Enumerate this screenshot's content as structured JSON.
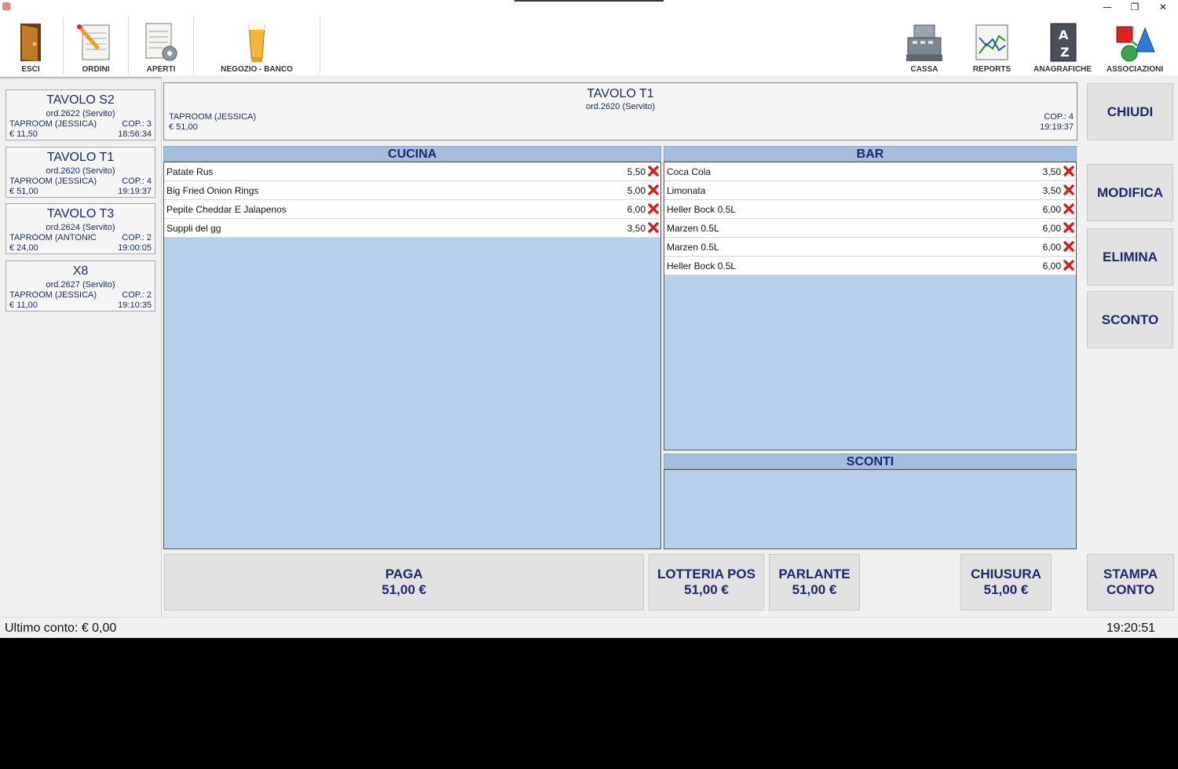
{
  "window": {
    "minimize_glyph": "—",
    "restore_glyph": "❐",
    "close_glyph": "✕"
  },
  "toolbar": {
    "esci": "ESCI",
    "ordini": "ORDINI",
    "aperti": "APERTI",
    "negozio": "NEGOZIO - BANCO",
    "cassa": "CASSA",
    "reports": "REPORTS",
    "anagrafiche": "ANAGRAFICHE",
    "associazioni": "ASSOCIAZIONI"
  },
  "tables": [
    {
      "name": "TAVOLO S2",
      "order": "ord.2622 (Servito)",
      "room": "TAPROOM (JESSICA)",
      "cop": "COP.: 3",
      "price": "€ 11,50",
      "time": "18:56:34"
    },
    {
      "name": "TAVOLO T1",
      "order": "ord.2620 (Servito)",
      "room": "TAPROOM (JESSICA)",
      "cop": "COP.: 4",
      "price": "€ 51,00",
      "time": "19:19:37"
    },
    {
      "name": "TAVOLO T3",
      "order": "ord.2624 (Servito)",
      "room": "TAPROOM (ANTONIC",
      "cop": "COP.: 2",
      "price": "€ 24,00",
      "time": "19:00:05"
    },
    {
      "name": "X8",
      "order": "ord.2627 (Servito)",
      "room": "TAPROOM (JESSICA)",
      "cop": "COP.: 2",
      "price": "€ 11,00",
      "time": "19:10:35"
    }
  ],
  "header": {
    "title": "TAVOLO T1",
    "order": "ord.2620 (Servito)",
    "room": "TAPROOM (JESSICA)",
    "price": "€ 51,00",
    "cop": "COP.: 4",
    "time": "19:19:37"
  },
  "cucina": {
    "title": "CUCINA",
    "items": [
      {
        "name": "Patate Rus",
        "price": "5,50"
      },
      {
        "name": "Big Fried Onion Rings",
        "price": "5,00"
      },
      {
        "name": "Pepite Cheddar E Jalapenos",
        "price": "6,00"
      },
      {
        "name": "Suppli del gg",
        "price": "3,50"
      }
    ]
  },
  "bar": {
    "title": "BAR",
    "items": [
      {
        "name": "Coca Cola",
        "price": "3,50"
      },
      {
        "name": "Limonata",
        "price": "3,50"
      },
      {
        "name": "Heller Bock 0.5L",
        "price": "6,00"
      },
      {
        "name": "Marzen 0.5L",
        "price": "6,00"
      },
      {
        "name": "Marzen 0.5L",
        "price": "6,00"
      },
      {
        "name": "Heller Bock 0.5L",
        "price": "6,00"
      }
    ]
  },
  "sconti": {
    "title": "SCONTI"
  },
  "actions": {
    "chiudi": "CHIUDI",
    "modifica": "MODIFICA",
    "elimina": "ELIMINA",
    "sconto": "SCONTO"
  },
  "bottom": {
    "paga": {
      "label": "PAGA",
      "amount": "51,00 €"
    },
    "lotteria": {
      "label": "LOTTERIA POS",
      "amount": "51,00 €"
    },
    "parlante": {
      "label": "PARLANTE",
      "amount": "51,00 €"
    },
    "chiusura": {
      "label": "CHIUSURA",
      "amount": "51,00 €"
    },
    "stampa": {
      "line1": "STAMPA",
      "line2": "CONTO"
    }
  },
  "status": {
    "last_bill": "Ultimo conto: € 0,00",
    "clock": "19:20:51"
  },
  "colors": {
    "accent": "#1a2a6c",
    "panel_bg": "#b8d1ea",
    "panel_header": "#a4bfde",
    "delete_red": "#d42020"
  }
}
